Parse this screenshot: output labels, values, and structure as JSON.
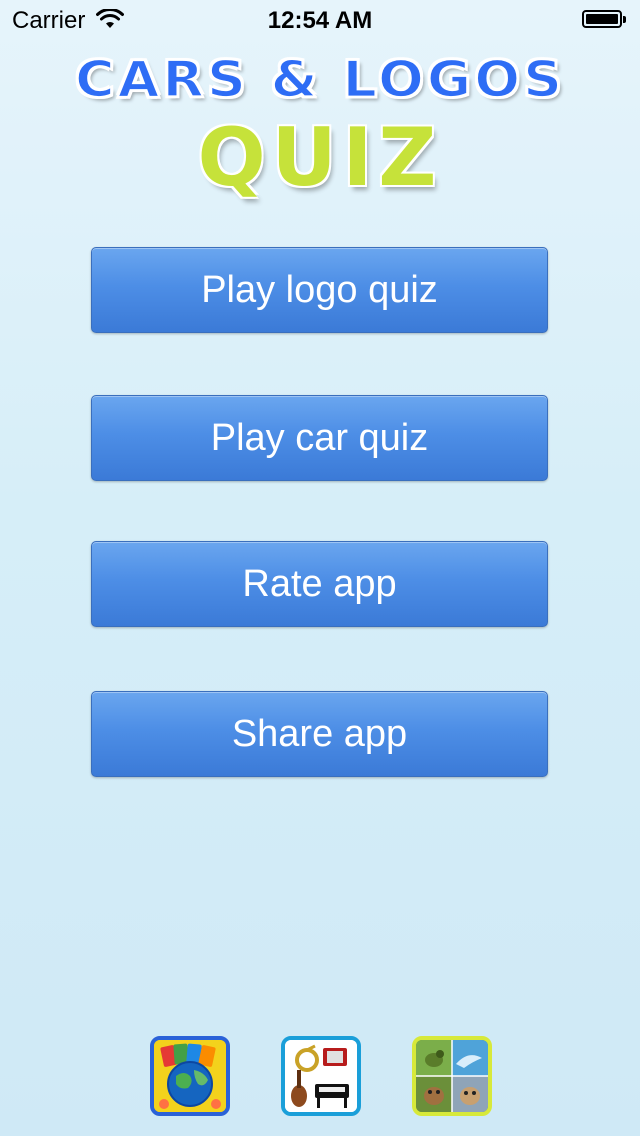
{
  "status_bar": {
    "carrier": "Carrier",
    "time": "12:54 AM",
    "wifi_icon": "wifi-icon",
    "battery_icon": "battery-icon",
    "battery_level": 1.0
  },
  "logo": {
    "line1": "CARS & LOGOS",
    "line2": "QUIZ",
    "colors": {
      "line1": "#2e6df5",
      "line2": "#c6e23a"
    }
  },
  "menu": {
    "buttons": [
      {
        "label": "Play logo quiz"
      },
      {
        "label": "Play car quiz"
      },
      {
        "label": "Rate app"
      },
      {
        "label": "Share app"
      }
    ],
    "button_color": "#4d8ee6"
  },
  "promo_apps": [
    {
      "icon": "flags-globe-quiz-app-icon"
    },
    {
      "icon": "musical-instruments-quiz-app-icon"
    },
    {
      "icon": "animals-quiz-app-icon"
    }
  ]
}
